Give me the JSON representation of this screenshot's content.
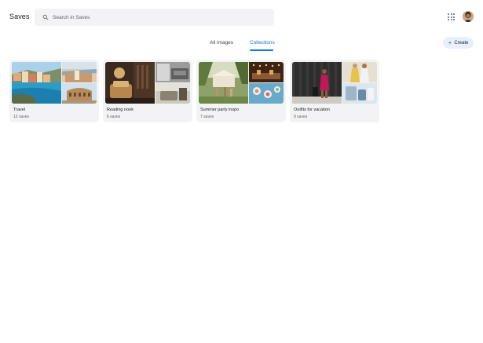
{
  "app": {
    "title": "Saves"
  },
  "search": {
    "placeholder": "Search in Saves",
    "value": ""
  },
  "tabs": [
    {
      "label": "All images",
      "active": false
    },
    {
      "label": "Collections",
      "active": true
    }
  ],
  "create": {
    "label": "Create"
  },
  "collections": [
    {
      "title": "Travel",
      "count": "12 saves"
    },
    {
      "title": "Reading nook",
      "count": "6 saves"
    },
    {
      "title": "Summer party inspo",
      "count": "7 saves"
    },
    {
      "title": "Outfits for vacation",
      "count": "9 saves"
    }
  ],
  "colors": {
    "accent": "#1a73e8",
    "search_bg": "#f1f3f4",
    "card_bg": "#f1f3f4",
    "create_bg": "#e8f0fe"
  }
}
